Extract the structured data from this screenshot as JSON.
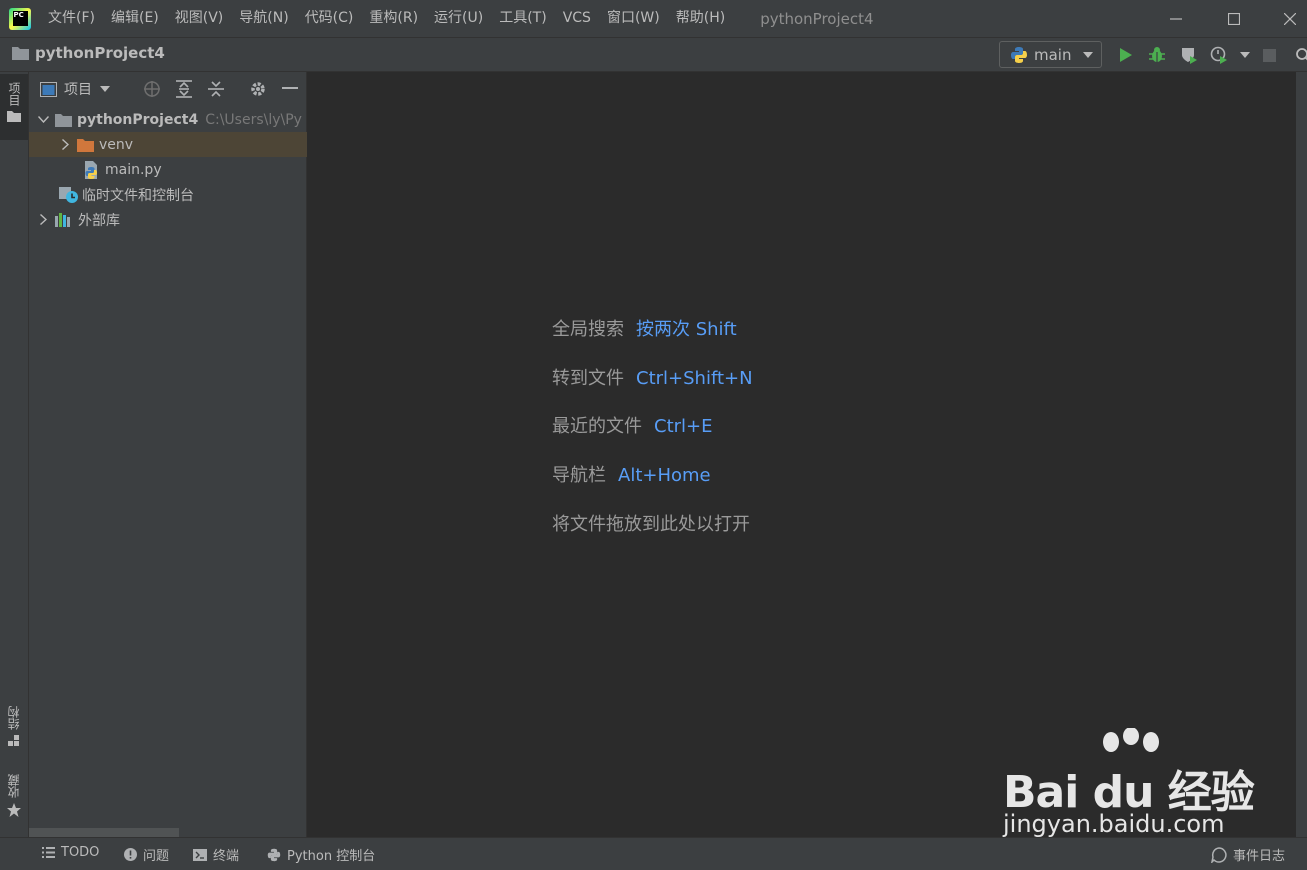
{
  "titlebar": {
    "menus": [
      "文件(F)",
      "编辑(E)",
      "视图(V)",
      "导航(N)",
      "代码(C)",
      "重构(R)",
      "运行(U)",
      "工具(T)",
      "VCS",
      "窗口(W)",
      "帮助(H)"
    ],
    "window_title": "pythonProject4",
    "logo_text": "PC"
  },
  "navbar": {
    "project_label": "pythonProject4",
    "run_config": "main"
  },
  "left_stripe": {
    "project_tab": "项目",
    "structure_tab": "结构",
    "favorites_tab": "收藏"
  },
  "project_panel": {
    "title": "项目",
    "tree": {
      "root_name": "pythonProject4",
      "root_path": "C:\\Users\\ly\\Py",
      "venv": "venv",
      "main_file": "main.py",
      "scratches": "临时文件和控制台",
      "external_libs": "外部库"
    }
  },
  "editor": {
    "hints": [
      {
        "text": "全局搜索",
        "key": "按两次 Shift"
      },
      {
        "text": "转到文件",
        "key": "Ctrl+Shift+N"
      },
      {
        "text": "最近的文件",
        "key": "Ctrl+E"
      },
      {
        "text": "导航栏",
        "key": "Alt+Home"
      }
    ],
    "drop_hint": "将文件拖放到此处以打开"
  },
  "watermark": {
    "brand": "Bai du 经验",
    "url": "jingyan.baidu.com"
  },
  "statusbar": {
    "todo": "TODO",
    "problems": "问题",
    "terminal": "终端",
    "python_console": "Python 控制台",
    "event_log": "事件日志"
  },
  "colors": {
    "accent_link": "#589df6",
    "run_green": "#4caf50",
    "folder_orange": "#d0773c",
    "selection": "#4d4536"
  }
}
